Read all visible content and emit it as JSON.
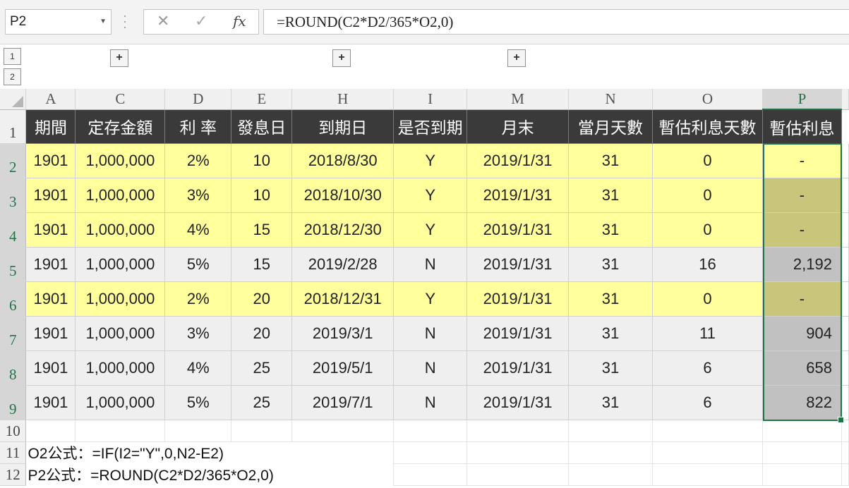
{
  "formula_bar": {
    "name_box": "P2",
    "cancel_icon": "✕",
    "enter_icon": "✓",
    "fx_label": "fx",
    "formula": "=ROUND(C2*D2/365*O2,0)"
  },
  "outline": {
    "levels": [
      "1",
      "2"
    ],
    "expand_symbol": "+"
  },
  "columns": [
    "A",
    "C",
    "D",
    "E",
    "H",
    "I",
    "M",
    "N",
    "O",
    "P"
  ],
  "row_numbers": [
    "1",
    "2",
    "3",
    "4",
    "5",
    "6",
    "7",
    "8",
    "9",
    "10",
    "11",
    "12"
  ],
  "header": [
    "期間",
    "定存金額",
    "利 率",
    "發息日",
    "到期日",
    "是否到期",
    "月末",
    "當月天數",
    "暫估利息天數",
    "暫估利息"
  ],
  "rows": [
    [
      "1901",
      "1,000,000",
      "2%",
      "10",
      "2018/8/30",
      "Y",
      "2019/1/31",
      "31",
      "0",
      "-"
    ],
    [
      "1901",
      "1,000,000",
      "3%",
      "10",
      "2018/10/30",
      "Y",
      "2019/1/31",
      "31",
      "0",
      "-"
    ],
    [
      "1901",
      "1,000,000",
      "4%",
      "15",
      "2018/12/30",
      "Y",
      "2019/1/31",
      "31",
      "0",
      "-"
    ],
    [
      "1901",
      "1,000,000",
      "5%",
      "15",
      "2019/2/28",
      "N",
      "2019/1/31",
      "31",
      "16",
      "2,192"
    ],
    [
      "1901",
      "1,000,000",
      "2%",
      "20",
      "2018/12/31",
      "Y",
      "2019/1/31",
      "31",
      "0",
      "-"
    ],
    [
      "1901",
      "1,000,000",
      "3%",
      "20",
      "2019/3/1",
      "N",
      "2019/1/31",
      "31",
      "11",
      "904"
    ],
    [
      "1901",
      "1,000,000",
      "4%",
      "25",
      "2019/5/1",
      "N",
      "2019/1/31",
      "31",
      "6",
      "658"
    ],
    [
      "1901",
      "1,000,000",
      "5%",
      "25",
      "2019/7/1",
      "N",
      "2019/1/31",
      "31",
      "6",
      "822"
    ]
  ],
  "notes": [
    "O2公式：=IF(I2=\"Y\",0,N2-E2)",
    "P2公式：=ROUND(C2*D2/365*O2,0)"
  ],
  "colors": {
    "header_bg": "#3a3a3a",
    "due_row_bg": "#ffff9c",
    "not_due_row_bg": "#efefef",
    "selection": "#217346"
  }
}
